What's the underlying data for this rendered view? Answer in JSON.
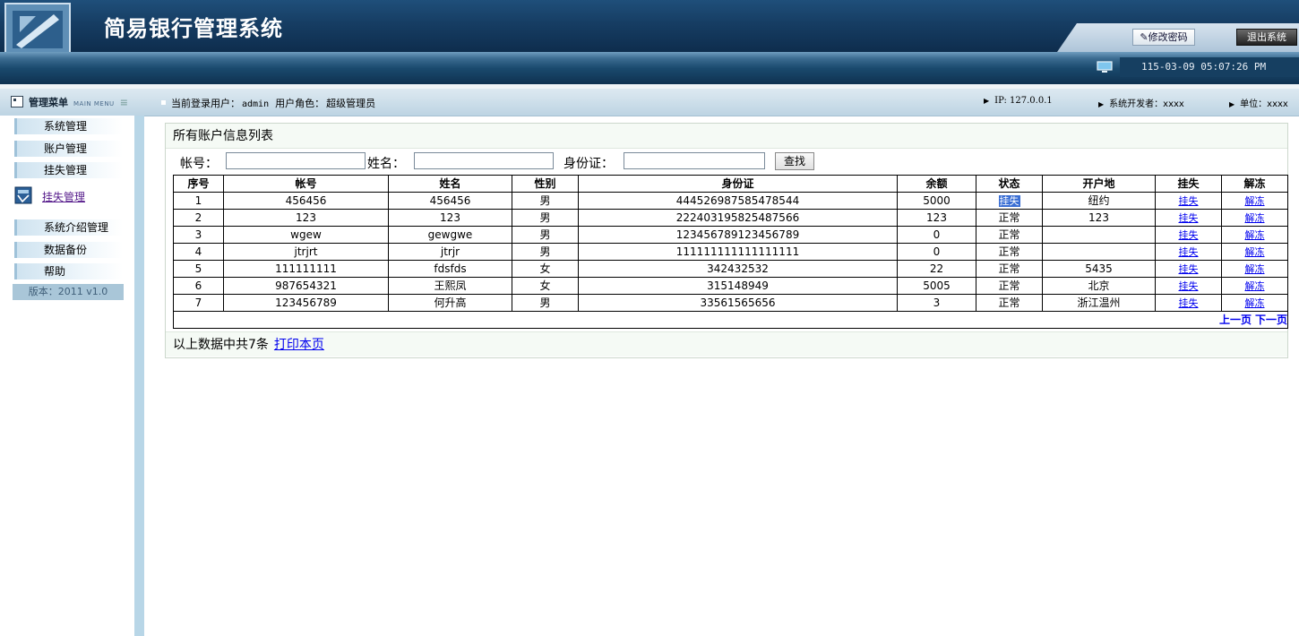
{
  "app": {
    "title": "简易银行管理系统"
  },
  "header": {
    "change_password": "修改密码",
    "logout": "退出系统",
    "datetime": "115-03-09 05:07:26 PM"
  },
  "infobar": {
    "menu_title": "管理菜单",
    "menu_subtitle": "MAIN MENU",
    "user_label": "当前登录用户：",
    "user_value": "admin",
    "role_label": "用户角色：",
    "role_value": "超级管理员",
    "ip": "IP: 127.0.0.1",
    "developer": "系统开发者：xxxx",
    "unit": "单位：xxxx"
  },
  "sidebar": {
    "items": [
      "系统管理",
      "账户管理",
      "挂失管理"
    ],
    "active_item": "挂失管理",
    "items_after": [
      "系统介绍管理",
      "数据备份",
      "帮助"
    ],
    "version": "版本：2011 v1.0"
  },
  "panel": {
    "title": "所有账户信息列表",
    "footer_text": "以上数据中共7条",
    "print_link": "打印本页"
  },
  "search": {
    "account_label": "帐号：",
    "name_label": "姓名：",
    "id_label": "身份证：",
    "button": "查找"
  },
  "table": {
    "headers": [
      "序号",
      "帐号",
      "姓名",
      "性别",
      "身份证",
      "余额",
      "状态",
      "开户地",
      "挂失",
      "解冻"
    ],
    "rows": [
      [
        "1",
        "456456",
        "456456",
        "男",
        "444526987585478544",
        "5000",
        "挂失",
        "纽约",
        "挂失",
        "解冻"
      ],
      [
        "2",
        "123",
        "123",
        "男",
        "222403195825487566",
        "123",
        "正常",
        "123",
        "挂失",
        "解冻"
      ],
      [
        "3",
        "wgew",
        "gewgwe",
        "男",
        "123456789123456789",
        "0",
        "正常",
        "",
        "挂失",
        "解冻"
      ],
      [
        "4",
        "jtrjrt",
        "jtrjr",
        "男",
        "111111111111111111",
        "0",
        "正常",
        "",
        "挂失",
        "解冻"
      ],
      [
        "5",
        "111111111",
        "fdsfds",
        "女",
        "342432532",
        "22",
        "正常",
        "5435",
        "挂失",
        "解冻"
      ],
      [
        "6",
        "987654321",
        "王熙凤",
        "女",
        "315148949",
        "5005",
        "正常",
        "北京",
        "挂失",
        "解冻"
      ],
      [
        "7",
        "123456789",
        "何升高",
        "男",
        "33561565656",
        "3",
        "正常",
        "浙江温州",
        "挂失",
        "解冻"
      ]
    ],
    "pager": {
      "prev": "上一页",
      "next": "下一页"
    }
  },
  "colors": {
    "header_bg": "#163d63",
    "link": "#0000ee",
    "sidebar_border": "#b8d6e7"
  }
}
